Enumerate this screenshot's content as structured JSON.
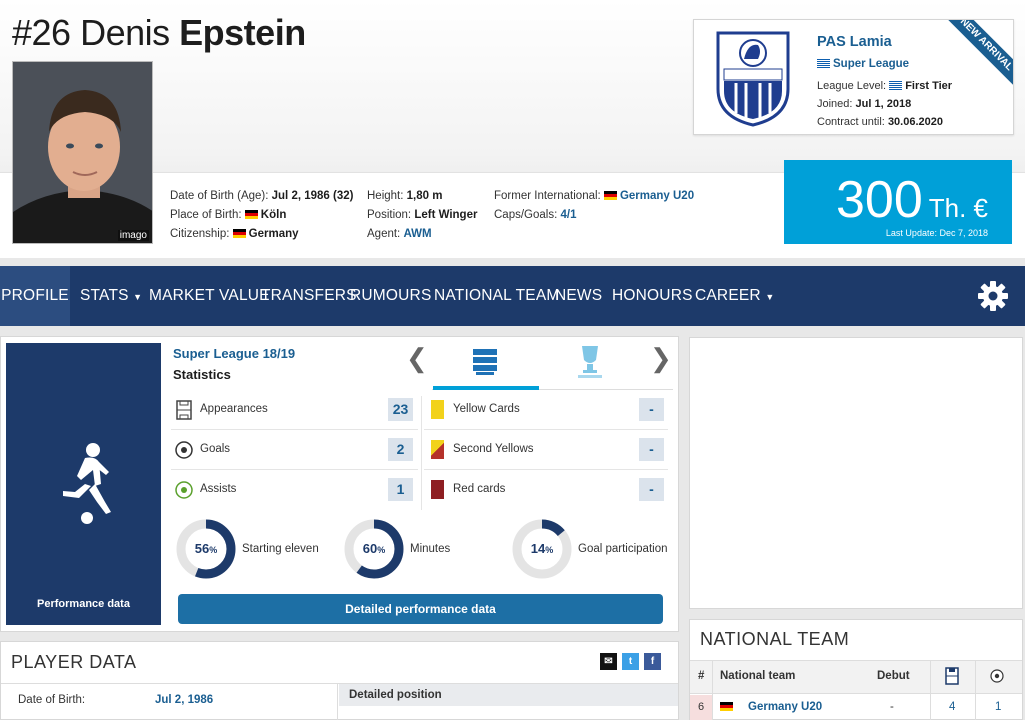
{
  "player": {
    "number": "#26",
    "first_name": "Denis",
    "last_name": "Epstein",
    "photo_caption": "imago"
  },
  "info": {
    "dob_label": "Date of Birth (Age):",
    "dob_value": "Jul 2, 1986 (32)",
    "pob_label": "Place of Birth:",
    "pob_value": "Köln",
    "citizenship_label": "Citizenship:",
    "citizenship_value": "Germany",
    "height_label": "Height:",
    "height_value": "1,80 m",
    "position_label": "Position:",
    "position_value": "Left Winger",
    "agent_label": "Agent:",
    "agent_value": "AWM",
    "former_int_label": "Former International:",
    "former_int_value": "Germany U20",
    "caps_label": "Caps/Goals:",
    "caps_value": "4/1"
  },
  "club": {
    "name": "PAS Lamia",
    "league": "Super League",
    "league_level_label": "League Level:",
    "league_level_value": "First Tier",
    "joined_label": "Joined:",
    "joined_value": "Jul 1, 2018",
    "contract_label": "Contract until:",
    "contract_value": "30.06.2020",
    "ribbon": "NEW ARRIVAL"
  },
  "market_value": {
    "value": "300",
    "unit": "Th. €",
    "last_update": "Last Update: Dec 7, 2018"
  },
  "nav": {
    "items": [
      "PROFILE",
      "STATS",
      "MARKET VALUE",
      "TRANSFERS",
      "RUMOURS",
      "NATIONAL TEAM",
      "NEWS",
      "HONOURS",
      "CAREER"
    ]
  },
  "stats": {
    "panel_label": "Performance data",
    "league_title": "Super League 18/19",
    "subtitle": "Statistics",
    "prev_arrow": "❮",
    "next_arrow": "❯",
    "rows_left": [
      {
        "label": "Appearances",
        "value": "23"
      },
      {
        "label": "Goals",
        "value": "2"
      },
      {
        "label": "Assists",
        "value": "1"
      }
    ],
    "rows_right": [
      {
        "label": "Yellow Cards",
        "value": "-"
      },
      {
        "label": "Second Yellows",
        "value": "-"
      },
      {
        "label": "Red cards",
        "value": "-"
      }
    ],
    "donuts": [
      {
        "label": "Starting eleven",
        "pct": "56",
        "fraction": 0.56
      },
      {
        "label": "Minutes",
        "pct": "60",
        "fraction": 0.6
      },
      {
        "label": "Goal participation",
        "pct": "14",
        "fraction": 0.14
      }
    ],
    "percent_sign": "%",
    "detail_button": "Detailed performance data"
  },
  "national_team": {
    "title": "NATIONAL TEAM",
    "headers": {
      "num": "#",
      "team": "National team",
      "debut": "Debut"
    },
    "row": {
      "num": "6",
      "team": "Germany U20",
      "debut": "-",
      "caps": "4",
      "goals": "1"
    }
  },
  "player_data": {
    "title": "PLAYER DATA",
    "dob_label": "Date of Birth:",
    "dob_value": "Jul 2, 1986",
    "detail_position": "Detailed position"
  },
  "colors": {
    "navy": "#1d3a6a",
    "accent": "#00a0d8",
    "link": "#1a5e91"
  }
}
